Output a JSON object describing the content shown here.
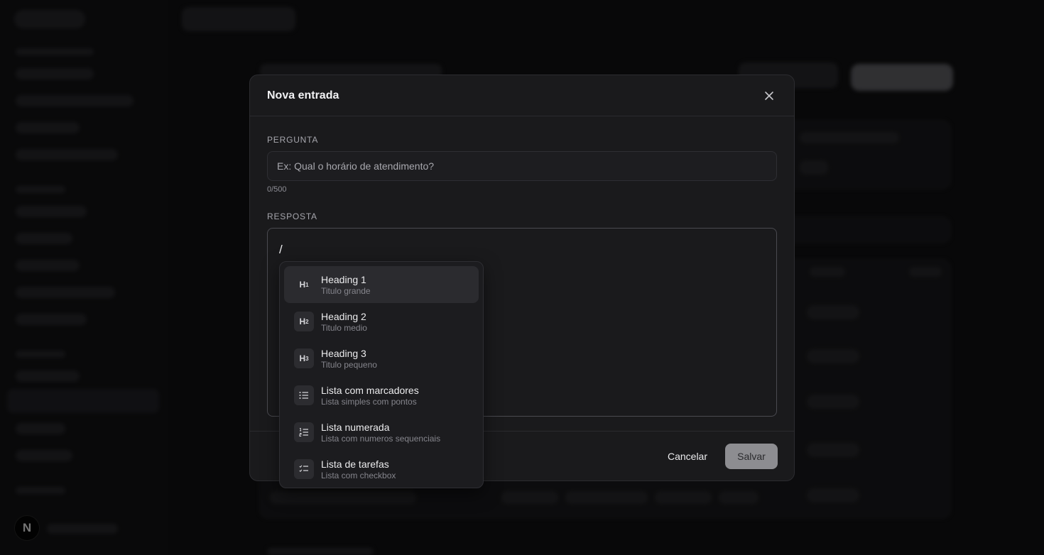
{
  "modal": {
    "title": "Nova entrada",
    "question": {
      "label": "PERGUNTA",
      "placeholder": "Ex: Qual o horário de atendimento?",
      "value": "",
      "counter": "0/500"
    },
    "answer": {
      "label": "RESPOSTA",
      "value": "/"
    },
    "footer": {
      "cancel_label": "Cancelar",
      "save_label": "Salvar"
    }
  },
  "slash_menu": {
    "items": [
      {
        "icon": "heading-1-icon",
        "glyph": "H",
        "sub": "1",
        "label": "Heading 1",
        "description": "Titulo grande",
        "active": true
      },
      {
        "icon": "heading-2-icon",
        "glyph": "H",
        "sub": "2",
        "label": "Heading 2",
        "description": "Titulo medio",
        "active": false
      },
      {
        "icon": "heading-3-icon",
        "glyph": "H",
        "sub": "3",
        "label": "Heading 3",
        "description": "Titulo pequeno",
        "active": false
      },
      {
        "icon": "bullet-list-icon",
        "label": "Lista com marcadores",
        "description": "Lista simples com pontos",
        "active": false
      },
      {
        "icon": "numbered-list-icon",
        "label": "Lista numerada",
        "description": "Lista com numeros sequenciais",
        "active": false
      },
      {
        "icon": "task-list-icon",
        "label": "Lista de tarefas",
        "description": "Lista com checkbox",
        "active": false
      }
    ]
  },
  "background": {
    "avatar_letter": "N"
  },
  "colors": {
    "modal_bg": "#1a1a1c",
    "save_button_bg": "#8d8d91",
    "page_bg": "#121214"
  }
}
